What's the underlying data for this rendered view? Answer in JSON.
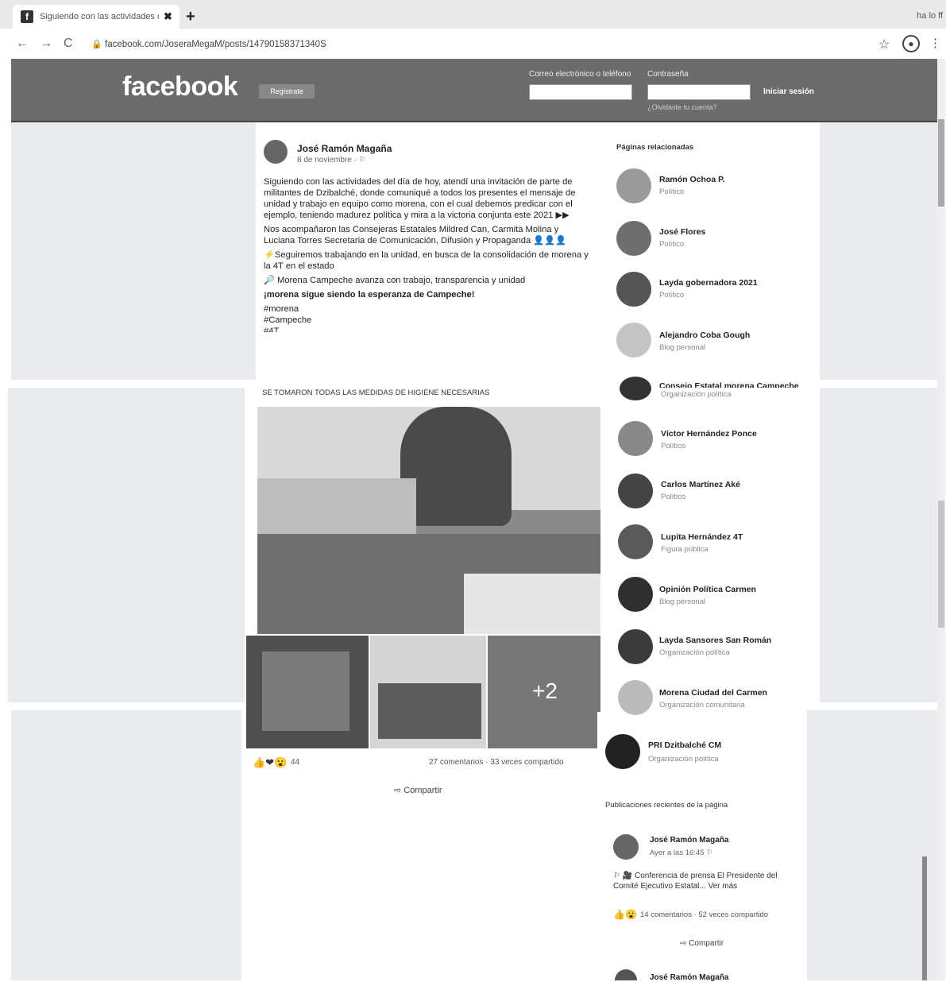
{
  "browser": {
    "tab_title": "Siguiendo con las actividades d",
    "tab_close": "✖",
    "new_tab": "+",
    "url": "facebook.com/JoseraMegaM/posts/14790158371340S",
    "profile_corner": "ha lo ff"
  },
  "header": {
    "logo": "facebook",
    "signup": "Regístrate",
    "email_label": "Correo electrónico o teléfono",
    "password_label": "Contraseña",
    "forgot": "¿Olvidaste tu cuenta?",
    "login": "Iniciar sesión"
  },
  "post": {
    "author": "José Ramón Magaña",
    "date": "8 de noviembre · ⚐",
    "paragraphs": [
      "Siguiendo con las actividades del día de hoy, atendí una invitación de parte de militantes de Dzibalché, donde comuniqué a todos los presentes el mensaje de unidad y trabajo en equipo como morena, con el cual debemos predicar con el ejemplo, teniendo madurez política y mira a la victoria conjunta este 2021 ▶▶",
      "Nos acompañaron las Consejeras Estatales Mildred Can, Carmita Molina y Luciana Torres Secretaria de Comunicación, Difusión y Propaganda 👤👤👤",
      "⚡Seguiremos trabajando en la unidad, en busca de la consolidación de morena y la 4T en el estado",
      "🔎 Morena Campeche avanza con trabajo, transparencia y unidad",
      "¡morena sigue siendo la esperanza de Campeche!",
      "#morena",
      "#Campeche",
      "#4T"
    ],
    "caption": "SE TOMARON TODAS LAS MEDIDAS DE HIGIENE NECESARIAS",
    "more_photos": "+2",
    "reactions_icons": "👍❤😮",
    "reactions_count": "44",
    "comments_shares": "27 comentarios · 33 veces compartido",
    "share": "⇨ Compartir"
  },
  "related": {
    "title": "Páginas relacionadas",
    "pages": [
      {
        "name": "Ramón Ochoa P.",
        "category": "Político"
      },
      {
        "name": "José Flores",
        "category": "Político"
      },
      {
        "name": "Layda gobernadora 2021",
        "category": "Político"
      },
      {
        "name": "Alejandro Coba Gough",
        "category": "Blog personal"
      },
      {
        "name": "Consejo Estatal morena Campeche",
        "category": "Organización política"
      },
      {
        "name": "Víctor Hernández Ponce",
        "category": "Político"
      },
      {
        "name": "Carlos Martínez Aké",
        "category": "Político"
      },
      {
        "name": "Lupita Hernández 4T",
        "category": "Figura pública"
      },
      {
        "name": "Opinión Política Carmen",
        "category": "Blog personal"
      },
      {
        "name": "Layda Sansores San Román",
        "category": "Organización política"
      },
      {
        "name": "Morena Ciudad del Carmen",
        "category": "Organización comunitaria"
      },
      {
        "name": "PRI Dzitbalché CM",
        "category": "Organización política"
      }
    ]
  },
  "recent": {
    "title": "Publicaciones recientes de la página",
    "author": "José Ramón Magaña",
    "date": "Ayer a las 16:45 ⚐",
    "text": "⚐ 🎥 Conferencia de prensa El Presidente del Comité Ejecutivo Estatal... Ver más",
    "icons": "👍😮",
    "comments_shares": "14 comentarios · 52 veces compartido",
    "share": "⇨ Compartir",
    "next_author": "José Ramón Magaña"
  }
}
